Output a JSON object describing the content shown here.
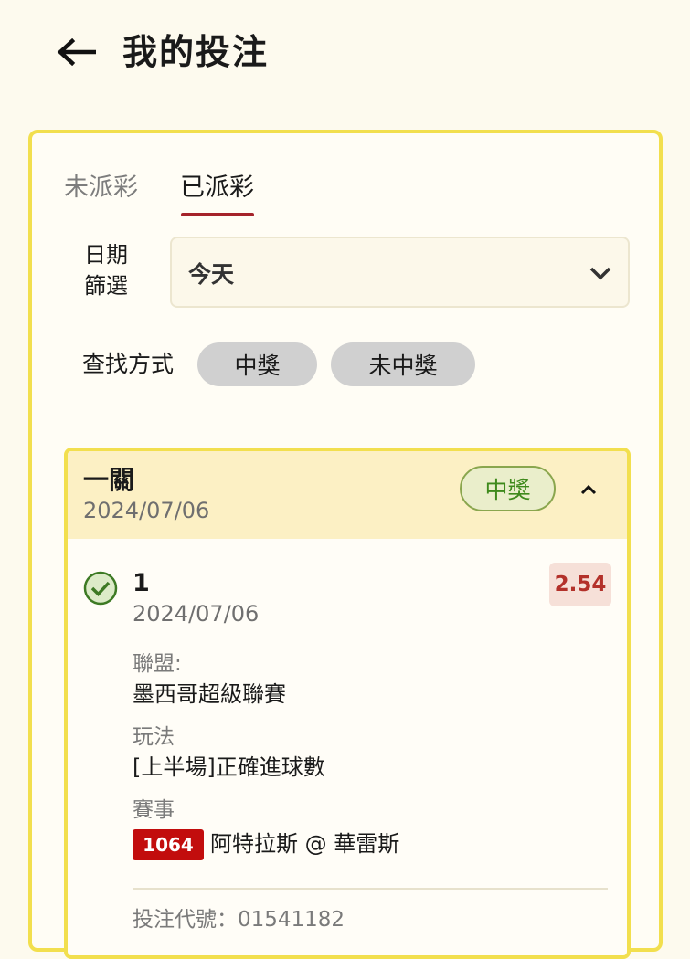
{
  "header": {
    "title": "我的投注",
    "back_icon": "arrow-left-icon"
  },
  "tabs": [
    {
      "label": "未派彩",
      "active": false
    },
    {
      "label": "已派彩",
      "active": true
    }
  ],
  "colors": {
    "accent_red": "#a5232a",
    "panel_border": "#f2df4e",
    "win_green": "#3f8a1c",
    "match_code_red": "#c20d0d"
  },
  "filter": {
    "date_label": "日期篩選",
    "date_value": "今天",
    "search_label": "查找方式",
    "chips": [
      "中獎",
      "未中獎"
    ]
  },
  "bet": {
    "type": "一關",
    "date": "2024/07/06",
    "status": "中獎",
    "legs": [
      {
        "index": "1",
        "date": "2024/07/06",
        "odds": "2.54",
        "league_label": "聯盟:",
        "league": "墨西哥超級聯賽",
        "play_label": "玩法",
        "play": "[上半場]正確進球數",
        "match_label": "賽事",
        "match_code": "1064",
        "match_name": "阿特拉斯 @ 華雷斯"
      }
    ],
    "ref_text": "投注代號：01541182"
  }
}
